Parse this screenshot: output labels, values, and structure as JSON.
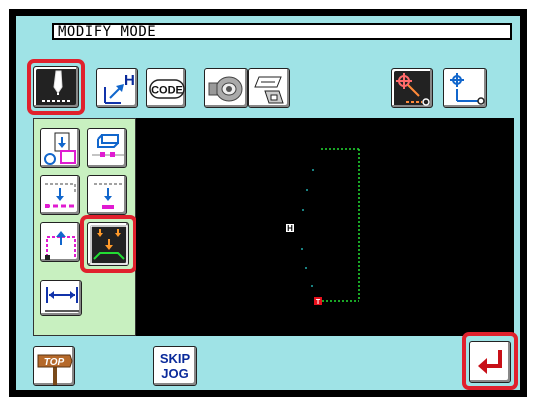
{
  "header": {
    "mode_title": "MODIFY MODE"
  },
  "toolbar": {
    "code_label": "CODE",
    "skip_jog": {
      "line1": "SKIP",
      "line2": "JOG"
    },
    "top_label": "TOP",
    "h_label": "H"
  },
  "canvas": {
    "home_marker": "H",
    "end_marker": "T",
    "stitch_color": "#22dd33"
  },
  "colors": {
    "highlight": "#e0212d",
    "panel": "#9fe3e6",
    "tool_green": "#c8f0c0"
  }
}
